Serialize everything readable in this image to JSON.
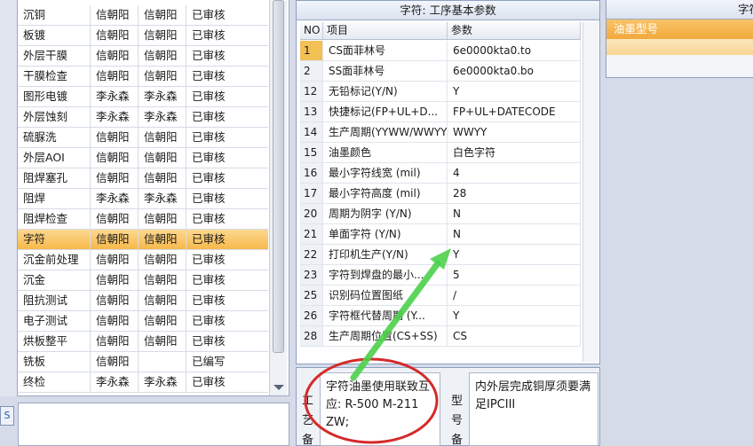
{
  "process_table": {
    "rows": [
      {
        "name": "沉铜",
        "user1": "信朝阳",
        "user2": "信朝阳",
        "status": "已审核"
      },
      {
        "name": "板镀",
        "user1": "信朝阳",
        "user2": "信朝阳",
        "status": "已审核"
      },
      {
        "name": "外层干膜",
        "user1": "信朝阳",
        "user2": "信朝阳",
        "status": "已审核"
      },
      {
        "name": "干膜检查",
        "user1": "信朝阳",
        "user2": "信朝阳",
        "status": "已审核"
      },
      {
        "name": "图形电镀",
        "user1": "李永森",
        "user2": "李永森",
        "status": "已审核"
      },
      {
        "name": "外层蚀刻",
        "user1": "李永森",
        "user2": "李永森",
        "status": "已审核"
      },
      {
        "name": "硫脲洗",
        "user1": "信朝阳",
        "user2": "信朝阳",
        "status": "已审核"
      },
      {
        "name": "外层AOI",
        "user1": "信朝阳",
        "user2": "信朝阳",
        "status": "已审核"
      },
      {
        "name": "阻焊塞孔",
        "user1": "信朝阳",
        "user2": "信朝阳",
        "status": "已审核"
      },
      {
        "name": "阻焊",
        "user1": "李永森",
        "user2": "李永森",
        "status": "已审核"
      },
      {
        "name": "阻焊检查",
        "user1": "信朝阳",
        "user2": "信朝阳",
        "status": "已审核"
      },
      {
        "name": "字符",
        "user1": "信朝阳",
        "user2": "信朝阳",
        "status": "已审核"
      },
      {
        "name": "沉金前处理",
        "user1": "信朝阳",
        "user2": "信朝阳",
        "status": "已审核"
      },
      {
        "name": "沉金",
        "user1": "信朝阳",
        "user2": "信朝阳",
        "status": "已审核"
      },
      {
        "name": "阻抗测试",
        "user1": "信朝阳",
        "user2": "信朝阳",
        "status": "已审核"
      },
      {
        "name": "电子测试",
        "user1": "信朝阳",
        "user2": "信朝阳",
        "status": "已审核"
      },
      {
        "name": "烘板整平",
        "user1": "信朝阳",
        "user2": "信朝阳",
        "status": "已审核"
      },
      {
        "name": "铣板",
        "user1": "信朝阳",
        "user2": "",
        "status": "已编写"
      },
      {
        "name": "终检",
        "user1": "李永森",
        "user2": "李永森",
        "status": "已审核"
      }
    ]
  },
  "left_tab": {
    "label": "S"
  },
  "params": {
    "title": "字符: 工序基本参数",
    "headers": {
      "no": "NO",
      "item": "项目",
      "value": "参数"
    },
    "rows": [
      {
        "no": "1",
        "item": "CS面菲林号",
        "value": "6e0000kta0.to"
      },
      {
        "no": "2",
        "item": "SS面菲林号",
        "value": "6e0000kta0.bo"
      },
      {
        "no": "12",
        "item": "无铅标记(Y/N)",
        "value": "Y"
      },
      {
        "no": "13",
        "item": "快捷标记(FP+UL+D...",
        "value": "FP+UL+DATECODE"
      },
      {
        "no": "14",
        "item": "生产周期(YYWW/WWYY)",
        "value": "WWYY"
      },
      {
        "no": "15",
        "item": "油墨颜色",
        "value": "白色字符"
      },
      {
        "no": "16",
        "item": "最小字符线宽 (mil)",
        "value": "4"
      },
      {
        "no": "17",
        "item": "最小字符高度 (mil)",
        "value": "28"
      },
      {
        "no": "20",
        "item": "周期为阴字 (Y/N)",
        "value": "N"
      },
      {
        "no": "21",
        "item": "单面字符 (Y/N)",
        "value": "N"
      },
      {
        "no": "22",
        "item": "打印机生产(Y/N)",
        "value": "Y"
      },
      {
        "no": "23",
        "item": "字符到焊盘的最小...",
        "value": "5"
      },
      {
        "no": "25",
        "item": "识别码位置图纸",
        "value": "/"
      },
      {
        "no": "26",
        "item": "字符框代替周期 (Y...",
        "value": "Y"
      },
      {
        "no": "28",
        "item": "生产周期位置(CS+SS)",
        "value": "CS"
      }
    ]
  },
  "notes": {
    "process_label": "工艺备",
    "process_text": "字符油墨使用联致互应: R-500 M-211 ZW;",
    "model_label": "型号备",
    "model_text": "内外层完成铜厚须要满足IPCIII"
  },
  "right_panel": {
    "title": "字符",
    "column_header": "油墨型号"
  },
  "colors": {
    "selection": "#f7b84a",
    "annotation_circle": "#d42a2a",
    "annotation_arrow": "#4cd14c"
  }
}
